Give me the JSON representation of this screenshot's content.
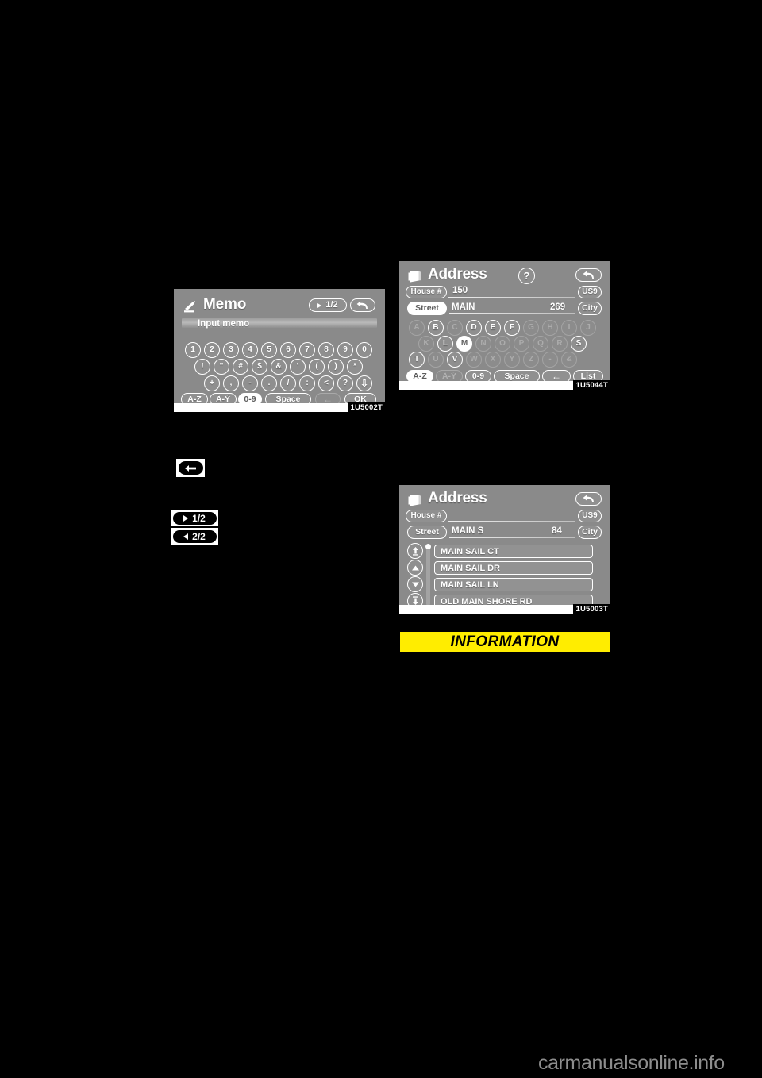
{
  "page": {
    "background_color": "#000000",
    "watermark": "carmanualsonline.info"
  },
  "figures": [
    {
      "id": "memo-keyboard",
      "code": "1U5002T",
      "title": "Memo",
      "title_icon": "memo-pen-icon",
      "page_button": "1/2",
      "back_button": "return-arrow-icon",
      "entry_label": "Input memo",
      "keyboard_rows": [
        [
          "1",
          "2",
          "3",
          "4",
          "5",
          "6",
          "7",
          "8",
          "9",
          "0"
        ],
        [
          "!",
          "\"",
          "#",
          "$",
          "&",
          "'",
          "(",
          ")",
          "*"
        ],
        [
          "+",
          ",",
          "-",
          ".",
          "/",
          ":",
          "<",
          "?",
          "⇩"
        ]
      ],
      "function_keys": [
        {
          "label": "A-Z",
          "state": "normal"
        },
        {
          "label": "À-Ý",
          "state": "normal"
        },
        {
          "label": "0-9",
          "state": "selected"
        },
        {
          "label": "Space",
          "state": "normal"
        },
        {
          "label": "←",
          "state": "normal"
        },
        {
          "label": "OK",
          "state": "normal"
        }
      ]
    },
    {
      "id": "address-keyboard",
      "code": "1U5044T",
      "title": "Address",
      "title_icon": "address-book-icon",
      "help_button": "?",
      "back_button": "return-arrow-icon",
      "fields": [
        {
          "label": "House #",
          "value": "150",
          "state": "normal",
          "side_button": "US9",
          "count": ""
        },
        {
          "label": "Street",
          "value": "MAIN",
          "state": "selected",
          "side_button": "City",
          "count": "269"
        }
      ],
      "letter_rows": [
        [
          {
            "c": "A",
            "state": "dim"
          },
          {
            "c": "B",
            "state": "normal"
          },
          {
            "c": "C",
            "state": "dim"
          },
          {
            "c": "D",
            "state": "normal"
          },
          {
            "c": "E",
            "state": "normal"
          },
          {
            "c": "F",
            "state": "normal"
          },
          {
            "c": "G",
            "state": "dim"
          },
          {
            "c": "H",
            "state": "dim"
          },
          {
            "c": "I",
            "state": "dim"
          },
          {
            "c": "J",
            "state": "dim"
          }
        ],
        [
          {
            "c": "K",
            "state": "dim"
          },
          {
            "c": "L",
            "state": "normal"
          },
          {
            "c": "M",
            "state": "selected"
          },
          {
            "c": "N",
            "state": "dim"
          },
          {
            "c": "O",
            "state": "dim"
          },
          {
            "c": "P",
            "state": "dim"
          },
          {
            "c": "Q",
            "state": "dim"
          },
          {
            "c": "R",
            "state": "dim"
          },
          {
            "c": "S",
            "state": "normal"
          }
        ],
        [
          {
            "c": "T",
            "state": "normal"
          },
          {
            "c": "U",
            "state": "dim"
          },
          {
            "c": "V",
            "state": "normal"
          },
          {
            "c": "W",
            "state": "dim"
          },
          {
            "c": "X",
            "state": "dim"
          },
          {
            "c": "Y",
            "state": "dim"
          },
          {
            "c": "Z",
            "state": "dim"
          },
          {
            "c": "-",
            "state": "dim"
          },
          {
            "c": "&",
            "state": "dim"
          }
        ]
      ],
      "function_keys": [
        {
          "label": "A-Z",
          "state": "selected"
        },
        {
          "label": "À-Ý",
          "state": "dim"
        },
        {
          "label": "0-9",
          "state": "normal"
        },
        {
          "label": "Space",
          "state": "normal"
        },
        {
          "label": "←",
          "state": "normal"
        },
        {
          "label": "List",
          "state": "normal"
        }
      ]
    },
    {
      "id": "address-street-list",
      "code": "1U5003T",
      "title": "Address",
      "title_icon": "address-book-icon",
      "back_button": "return-arrow-icon",
      "fields": [
        {
          "label": "House #",
          "value": "",
          "state": "normal",
          "side_button": "US9",
          "count": ""
        },
        {
          "label": "Street",
          "value": "MAIN S",
          "state": "normal",
          "side_button": "City",
          "count": "84"
        }
      ],
      "scroll_buttons": [
        "page-up-icon",
        "scroll-up-icon",
        "scroll-down-icon",
        "page-down-icon"
      ],
      "list_items": [
        "MAIN SAIL CT",
        "MAIN SAIL DR",
        "MAIN SAIL LN",
        "OLD MAIN SHORE RD"
      ]
    }
  ],
  "callouts": [
    {
      "id": "backspace-key",
      "type": "icon",
      "icon": "back-arrow-icon",
      "label": ""
    },
    {
      "id": "page-forward-key",
      "type": "labelled",
      "icon": "right-triangle-icon",
      "label": "1/2"
    },
    {
      "id": "page-back-key",
      "type": "labelled",
      "icon": "left-triangle-icon",
      "label": "2/2"
    }
  ],
  "information_banner": {
    "label": "INFORMATION",
    "background_color": "#ffed00",
    "text_color": "#000000"
  }
}
